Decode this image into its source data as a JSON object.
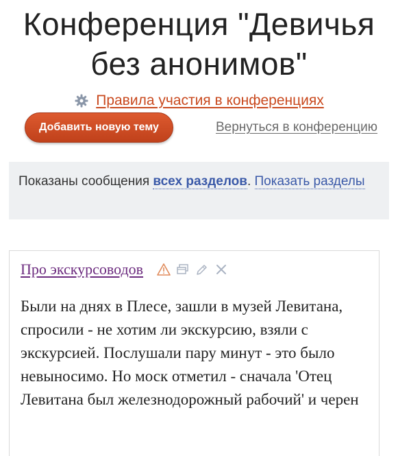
{
  "header": {
    "title_line1": "Конференция \"Девичья",
    "title_line2": "без анонимов\""
  },
  "rules": {
    "label": "Правила участия в конференциях",
    "icon": "gear-icon"
  },
  "actions": {
    "add_topic_label": "Добавить новую тему",
    "back_label": "Вернуться в конференцию"
  },
  "notice": {
    "prefix": "Показаны сообщения ",
    "all_sections": "всех разделов",
    "period": ". ",
    "show_sections": "Показать разделы"
  },
  "post": {
    "title": "Про экскурсоводов",
    "body": "Были на днях в Плесе, зашли в музей Левитана, спросили - не хотим ли экскурсию, взяли с экскурсией. Послушали пару минут - это было невыносимо. Но моск отметил - сначала 'Отец Левитана был железнодорожный рабочий' и черен"
  },
  "colors": {
    "accent": "#c9491e",
    "link_blue": "#3a59a8",
    "visited": "#6b2a7e"
  }
}
